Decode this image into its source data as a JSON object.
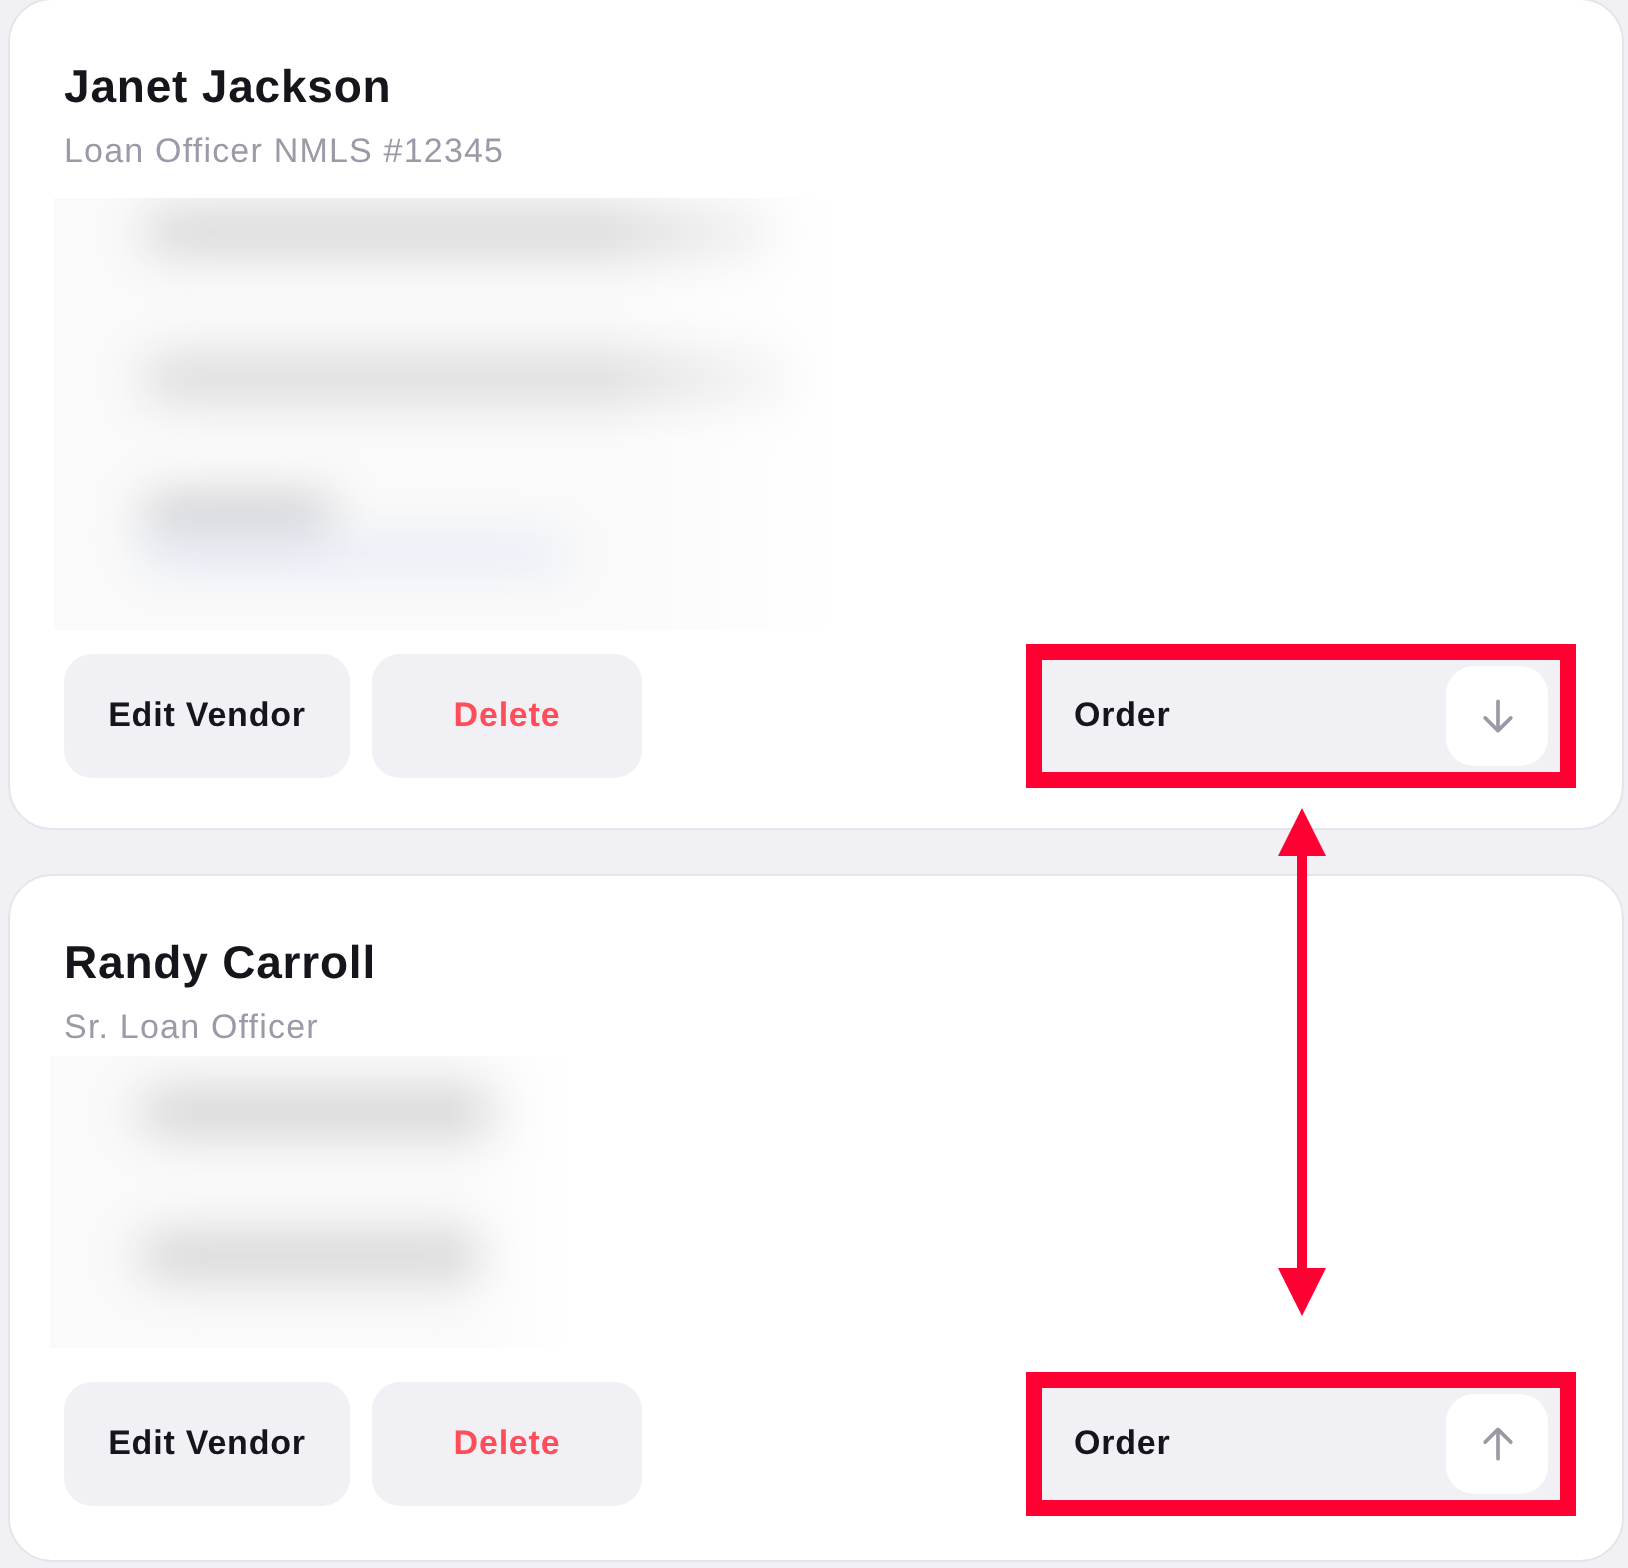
{
  "vendors": [
    {
      "name": "Janet Jackson",
      "title": "Loan Officer NMLS #12345",
      "details": {
        "kind": "wide"
      },
      "buttons": [
        {
          "label": "Edit Vendor",
          "kind": "default"
        },
        {
          "label": "Delete",
          "kind": "danger"
        }
      ],
      "order": {
        "label": "Order",
        "kind": "down",
        "highlighted": true
      }
    },
    {
      "name": "Randy Carroll",
      "title": "Sr. Loan Officer",
      "details": {
        "kind": "narrow"
      },
      "buttons": [
        {
          "label": "Edit Vendor",
          "kind": "default"
        },
        {
          "label": "Delete",
          "kind": "danger"
        }
      ],
      "order": {
        "label": "Order",
        "kind": "up",
        "highlighted": true
      }
    }
  ],
  "annotations": [
    {
      "kind": "double-arrow"
    }
  ]
}
